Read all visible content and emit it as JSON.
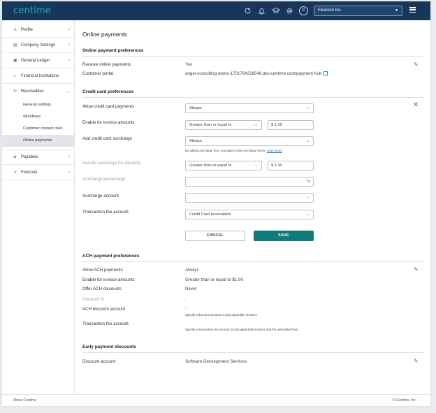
{
  "header": {
    "logo": "centime",
    "avatar_initials": "JF",
    "company": "Flexcore Inc",
    "icons": [
      "refresh-icon",
      "bell-icon",
      "graduation-cap-icon",
      "gear-icon",
      "menu-icon"
    ]
  },
  "sidebar": {
    "items": [
      {
        "label": "Profile",
        "icon": "person-icon"
      },
      {
        "label": "Company Settings",
        "icon": "building-icon"
      },
      {
        "label": "General Ledger",
        "icon": "ledger-icon"
      },
      {
        "label": "Financial Institutions",
        "icon": "bank-icon"
      },
      {
        "label": "Receivables",
        "icon": "receivables-icon"
      },
      {
        "label": "Payables",
        "icon": "payables-icon"
      },
      {
        "label": "Forecast",
        "icon": "forecast-icon"
      }
    ],
    "receivables_sub": [
      "General settings",
      "Workflows",
      "Customer contact roles",
      "Online payments"
    ],
    "active_sub": "Online payments"
  },
  "main": {
    "title": "Online payments",
    "online_prefs": {
      "header": "Online payment preferences",
      "receive_label": "Receive online payments",
      "receive_value": "Yes",
      "portal_label": "Customer portal",
      "portal_value": "angel-consulting-demo-1701794228548.dev.centime.com/payment-hub"
    },
    "cc_prefs": {
      "header": "Credit card preferences",
      "allow_label": "Allow credit card payments",
      "allow_value": "Always",
      "enable_label": "Enable for invoice amounts",
      "enable_op": "Greater than or equal to",
      "enable_amount": "$ 1.00",
      "surcharge_label": "Add credit card surcharge",
      "surcharge_value": "Always",
      "surcharge_note": "By adding surcharge fees, you agree to the surcharge terms.",
      "learn_more": "Learn more",
      "include_label": "Include surcharge for amounts",
      "include_op": "Greater than or equal to",
      "include_amount": "$ 1.00",
      "pct_label": "Surcharge percentage",
      "pct_symbol": "%",
      "account_label": "Surcharge account",
      "fee_label": "Transaction fee account",
      "fee_value": "Credit Card receivables",
      "cancel": "CANCEL",
      "save": "SAVE"
    },
    "ach_prefs": {
      "header": "ACH payment preferences",
      "allow_label": "Allow ACH payments",
      "allow_value": "Always",
      "enable_label": "Enable for invoice amounts",
      "enable_value": "Greater than or equal to $1.00",
      "discount_label": "Offer ACH discounts",
      "discount_value": "Never",
      "pct_label": "Discount %",
      "pct_value": "-",
      "disc_account_label": "ACH discount account",
      "disc_account_value": "-",
      "disc_account_note": "Specify a discount account to post applicable invoices.",
      "fee_label": "Transaction fee account",
      "fee_value": "-",
      "fee_note": "Specify a transaction fee account to post applicable invoices and the associated fees."
    },
    "early": {
      "header": "Early payment discounts",
      "account_label": "Discount account",
      "account_value": "Software Development Services"
    }
  },
  "footer": {
    "left": "About Centime",
    "right": "© Centime, Inc."
  }
}
